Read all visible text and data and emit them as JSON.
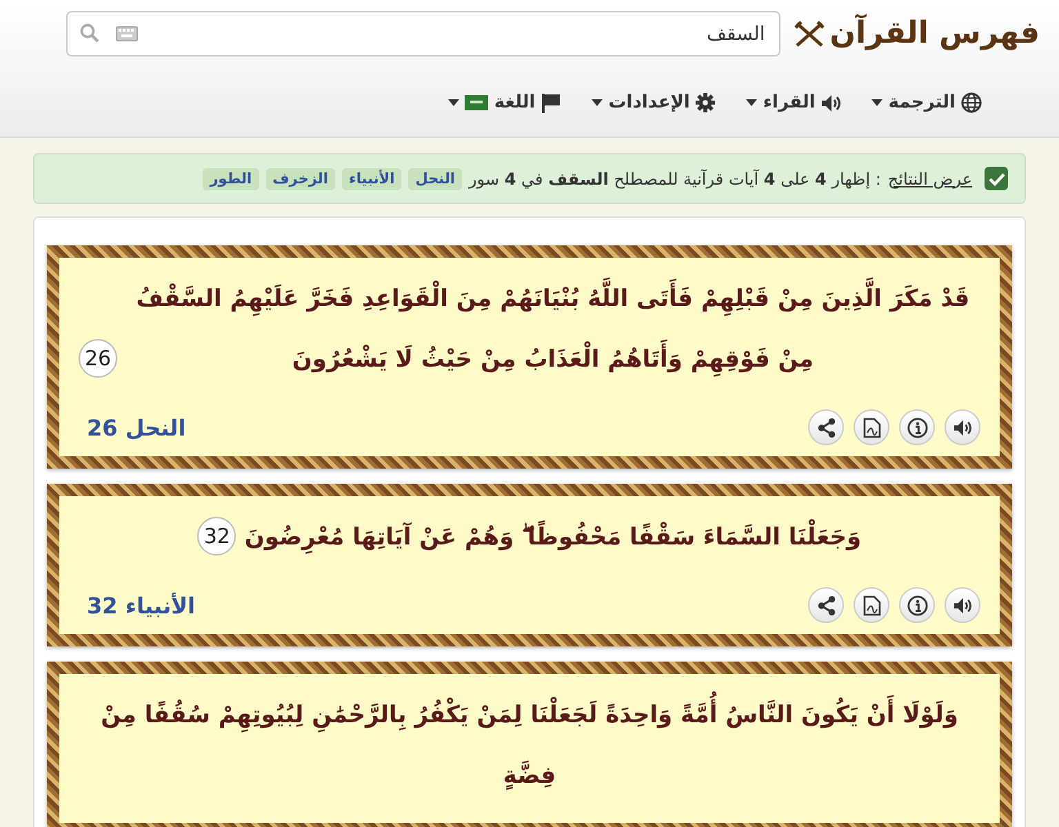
{
  "header": {
    "logo": "فهرس القرآن",
    "search": {
      "value": "السقف"
    },
    "menus": [
      {
        "kind": "globe",
        "label": "الترجمة"
      },
      {
        "kind": "speaker",
        "label": "القراء"
      },
      {
        "kind": "gear",
        "label": "الإعدادات"
      },
      {
        "kind": "flag",
        "label": "اللغة"
      }
    ]
  },
  "alert": {
    "checked": true,
    "link": "عرض النتائج",
    "summary": ": إظهار **4** على **4** آيات قرآنية للمصطلح **السقف** في **4** سور",
    "tags": [
      "النحل",
      "الأنبياء",
      "الزخرف",
      "الطور"
    ]
  },
  "verses": [
    {
      "text": "قَدْ مَكَرَ الَّذِينَ مِنْ قَبْلِهِمْ فَأَتَى اللَّهُ بُنْيَانَهُمْ مِنَ الْقَوَاعِدِ فَخَرَّ عَلَيْهِمُ السَّقْفُ مِنْ فَوْقِهِمْ وَأَتَاهُمُ الْعَذَابُ مِنْ حَيْثُ لَا يَشْعُرُونَ",
      "number": "26",
      "reference": "النحل 26",
      "actions": [
        {
          "kind": "audio"
        },
        {
          "kind": "info"
        },
        {
          "kind": "pdf"
        },
        {
          "kind": "share"
        }
      ]
    },
    {
      "text": "وَجَعَلْنَا السَّمَاءَ سَقْفًا مَحْفُوظًا ۖ وَهُمْ عَنْ آيَاتِهَا مُعْرِضُونَ",
      "number": "32",
      "reference": "الأنبياء 32",
      "actions": [
        {
          "kind": "audio"
        },
        {
          "kind": "info"
        },
        {
          "kind": "pdf"
        },
        {
          "kind": "share"
        }
      ]
    },
    {
      "text": "وَلَوْلَا أَنْ يَكُونَ النَّاسُ أُمَّةً وَاحِدَةً لَجَعَلْنَا لِمَنْ يَكْفُرُ بِالرَّحْمَٰنِ لِبُيُوتِهِمْ سُقُفًا مِنْ فِضَّةٍ"
    }
  ]
}
